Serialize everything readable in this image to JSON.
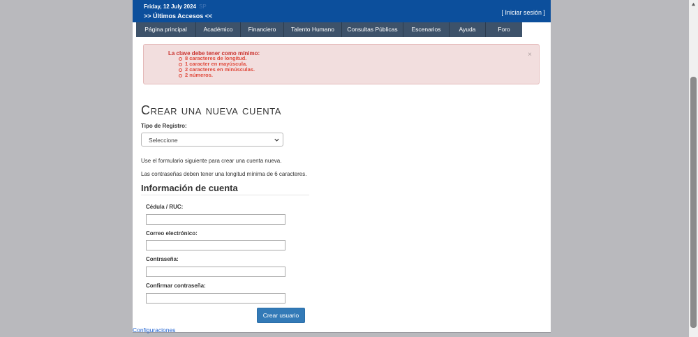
{
  "header": {
    "date": "Friday, 12 July 2024",
    "date_suffix": "SP",
    "accesos": ">> Últimos Accesos <<",
    "login": "[ Iniciar sesión ]"
  },
  "menu": [
    {
      "label": "Página principal"
    },
    {
      "label": "Académico"
    },
    {
      "label": "Financiero"
    },
    {
      "label": "Talento Humano"
    },
    {
      "label": "Consultas Públicas"
    },
    {
      "label": "Escenarios"
    },
    {
      "label": "Ayuda"
    },
    {
      "label": "Foro"
    }
  ],
  "alert": {
    "title": "La clave debe tener como mínimo:",
    "items": [
      "8 caracteres de longitud.",
      "1 caracter en mayúscula.",
      "2 caracteres en minúsculas.",
      "2 números."
    ],
    "close": "×"
  },
  "main": {
    "title": "Crear una nueva cuenta",
    "tipo_label": "Tipo de Registro:",
    "tipo_selected": "Seleccione",
    "note1": "Use el formulario siguiente para crear una cuenta nueva.",
    "note2": "Las contraseñas deben tener una longitud mínima de 6 caracteres.",
    "section": "Información de cuenta",
    "fields": {
      "cedula": {
        "label": "Cédula / RUC:",
        "value": ""
      },
      "correo": {
        "label": "Correo electrónico:",
        "value": ""
      },
      "password": {
        "label": "Contraseña:",
        "value": ""
      },
      "confirm": {
        "label": "Confirmar contraseña:",
        "value": ""
      }
    },
    "submit": "Crear usuario"
  },
  "footer": {
    "config": "Configuraciones"
  },
  "colors": {
    "header": "#0c4f9c",
    "menu": "#3d526a",
    "button": "#337ab7",
    "alert_bg": "#f2dede",
    "alert_text": "#c9302c"
  },
  "icons": {
    "select_chevron": "chevron-down-icon",
    "scroll_up": "chevron-up-icon"
  }
}
